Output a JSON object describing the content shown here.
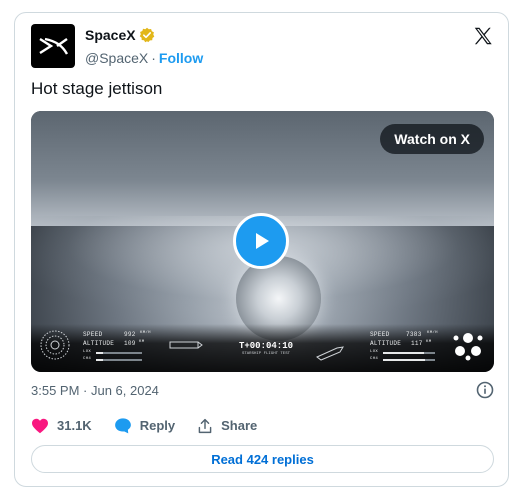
{
  "author": {
    "display_name": "SpaceX",
    "handle": "@SpaceX",
    "separator": "·",
    "follow_label": "Follow"
  },
  "tweet": {
    "text": "Hot stage jettison",
    "timestamp": "3:55 PM · Jun 6, 2024"
  },
  "media": {
    "watch_label": "Watch on X",
    "hud": {
      "left": {
        "speed_label": "SPEED",
        "speed_value": "992",
        "speed_unit": "KM/H",
        "altitude_label": "ALTITUDE",
        "altitude_value": "109",
        "altitude_unit": "KM",
        "lox_label": "LOX",
        "ch4_label": "CH4"
      },
      "center": {
        "time": "T+00:04:10",
        "subtitle": "STARSHIP FLIGHT TEST"
      },
      "right": {
        "speed_label": "SPEED",
        "speed_value": "7383",
        "speed_unit": "KM/H",
        "altitude_label": "ALTITUDE",
        "altitude_value": "117",
        "altitude_unit": "KM",
        "lox_label": "LOX",
        "ch4_label": "CH4"
      }
    }
  },
  "actions": {
    "like_count": "31.1K",
    "reply_label": "Reply",
    "share_label": "Share"
  },
  "read_replies_label": "Read 424 replies",
  "colors": {
    "accent": "#1d9bf0",
    "like": "#f91880",
    "link": "#006fd6",
    "verified": "#e2b719"
  },
  "icons": [
    "spacex-logo-icon",
    "verified-badge-icon",
    "x-logo-icon",
    "play-icon",
    "info-icon",
    "heart-icon",
    "reply-bubble-icon",
    "share-icon"
  ]
}
